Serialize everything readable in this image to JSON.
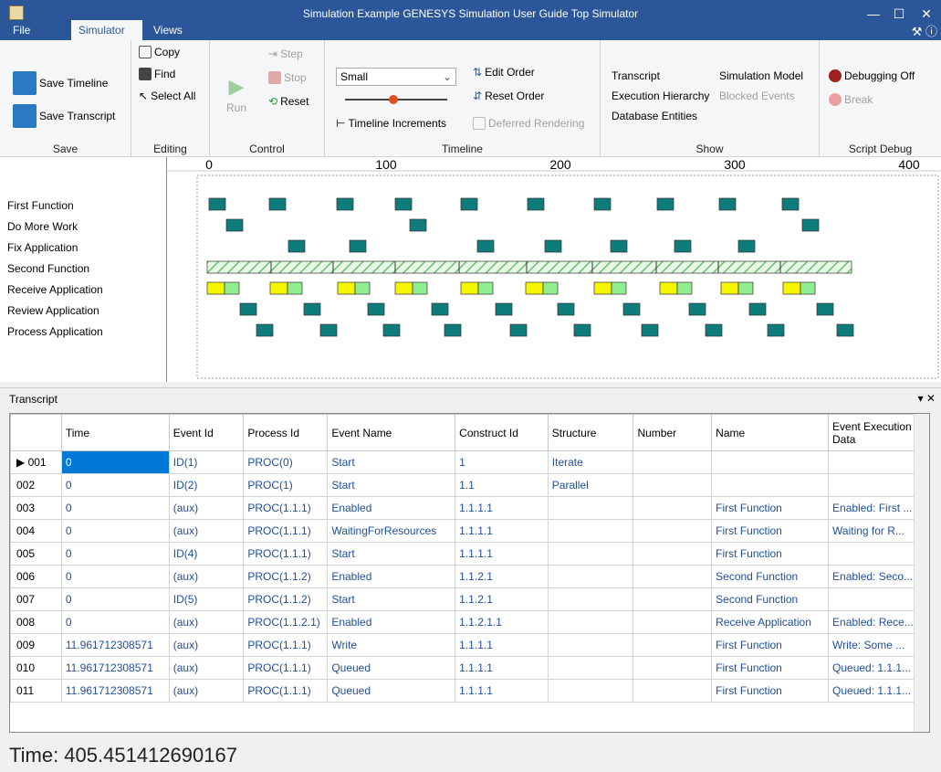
{
  "window": {
    "title": "Simulation Example GENESYS Simulation User Guide Top Simulator",
    "minimize": "—",
    "maximize": "☐",
    "close": "✕"
  },
  "menu": {
    "file": "File",
    "simulator": "Simulator",
    "views": "Views"
  },
  "ribbon": {
    "save": {
      "save_timeline": "Save Timeline",
      "save_transcript": "Save Transcript",
      "label": "Save"
    },
    "editing": {
      "copy": "Copy",
      "find": "Find",
      "select_all": "Select All",
      "label": "Editing"
    },
    "control": {
      "run": "Run",
      "step": "Step",
      "stop": "Stop",
      "reset": "Reset",
      "label": "Control"
    },
    "timeline": {
      "size": "Small",
      "timeline_increments": "Timeline Increments",
      "edit_order": "Edit Order",
      "reset_order": "Reset Order",
      "deferred_rendering": "Deferred Rendering",
      "label": "Timeline"
    },
    "show": {
      "transcript": "Transcript",
      "execution_hierarchy": "Execution Hierarchy",
      "database_entities": "Database Entities",
      "simulation_model": "Simulation Model",
      "blocked_events": "Blocked Events",
      "label": "Show"
    },
    "script_debug": {
      "debugging_off": "Debugging Off",
      "break": "Break",
      "label": "Script Debug"
    }
  },
  "timeline": {
    "axis_ticks": [
      "0",
      "100",
      "200",
      "300",
      "400"
    ],
    "rows": [
      "First Function",
      "Do More Work",
      "Fix Application",
      "Second Function",
      "Receive Application",
      "Review Application",
      "Process Application"
    ],
    "colors": {
      "block": "#0e7c7b",
      "yellow": "#f5f500",
      "green": "#90ee90",
      "hatch": "#7fd27f"
    }
  },
  "transcript": {
    "title": "Transcript",
    "controls": "▾ ✕",
    "columns": [
      "",
      "Time",
      "Event Id",
      "Process Id",
      "Event Name",
      "Construct Id",
      "Structure",
      "Number",
      "Name",
      "Event Execution Data"
    ],
    "rows": [
      [
        "▶ 001",
        "0",
        "ID(1)",
        "PROC(0)",
        "Start",
        "1",
        "Iterate",
        "",
        "",
        ""
      ],
      [
        "002",
        "0",
        "ID(2)",
        "PROC(1)",
        "Start",
        "1.1",
        "Parallel",
        "",
        "",
        ""
      ],
      [
        "003",
        "0",
        "(aux)",
        "PROC(1.1.1)",
        "Enabled",
        "1.1.1.1",
        "",
        "",
        "First Function",
        "Enabled: First ..."
      ],
      [
        "004",
        "0",
        "(aux)",
        "PROC(1.1.1)",
        "WaitingForResources",
        "1.1.1.1",
        "",
        "",
        "First Function",
        "Waiting for R..."
      ],
      [
        "005",
        "0",
        "ID(4)",
        "PROC(1.1.1)",
        "Start",
        "1.1.1.1",
        "",
        "",
        "First Function",
        ""
      ],
      [
        "006",
        "0",
        "(aux)",
        "PROC(1.1.2)",
        "Enabled",
        "1.1.2.1",
        "",
        "",
        "Second Function",
        "Enabled: Seco..."
      ],
      [
        "007",
        "0",
        "ID(5)",
        "PROC(1.1.2)",
        "Start",
        "1.1.2.1",
        "",
        "",
        "Second Function",
        ""
      ],
      [
        "008",
        "0",
        "(aux)",
        "PROC(1.1.2.1)",
        "Enabled",
        "1.1.2.1.1",
        "",
        "",
        "Receive Application",
        "Enabled: Rece..."
      ],
      [
        "009",
        "11.961712308571",
        "(aux)",
        "PROC(1.1.1)",
        "Write",
        "1.1.1.1",
        "",
        "",
        "First Function",
        "Write: Some ..."
      ],
      [
        "010",
        "11.961712308571",
        "(aux)",
        "PROC(1.1.1)",
        "Queued",
        "1.1.1.1",
        "",
        "",
        "First Function",
        "Queued: 1.1.1..."
      ],
      [
        "011",
        "11.961712308571",
        "(aux)",
        "PROC(1.1.1)",
        "Queued",
        "1.1.1.1",
        "",
        "",
        "First Function",
        "Queued: 1.1.1..."
      ]
    ]
  },
  "status": {
    "time": "Time: 405.451412690167"
  }
}
